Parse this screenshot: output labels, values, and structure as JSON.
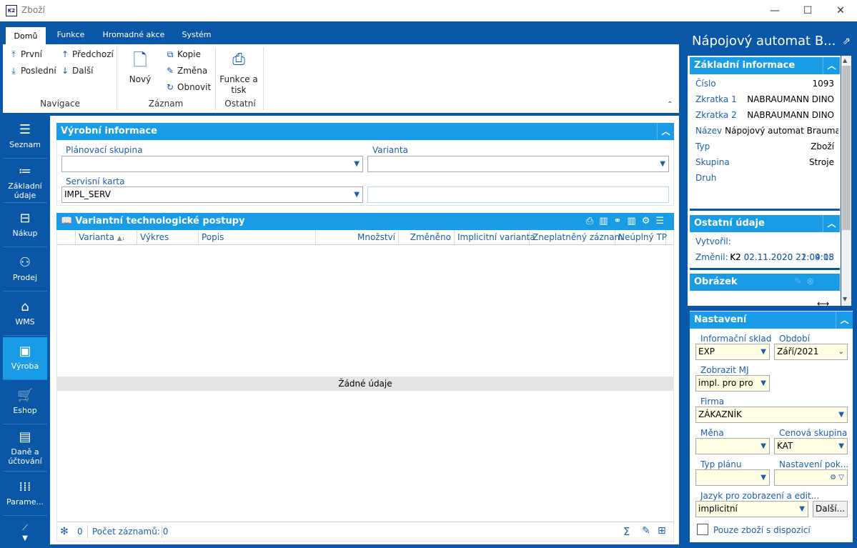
{
  "window": {
    "title": "Zboží",
    "icon": "K2",
    "buttons": [
      "—",
      "☐",
      "✕"
    ]
  },
  "ribbon": {
    "tabs": [
      "Domů",
      "Funkce",
      "Hromadné akce",
      "Systém"
    ],
    "nav": {
      "first": "První",
      "last": "Poslední",
      "prev": "Předchozí",
      "next": "Další",
      "group": "Navigace"
    },
    "record": {
      "new": "Nový",
      "copy": "Kopie",
      "change": "Změna",
      "refresh": "Obnovit",
      "group": "Záznam"
    },
    "other": {
      "print": "Funkce a tisk",
      "group": "Ostatní"
    }
  },
  "leftnav": [
    {
      "label": "Seznam",
      "icon": "list-icon"
    },
    {
      "label": "Základní údaje",
      "icon": "bullets-icon"
    },
    {
      "label": "Nákup",
      "icon": "purchase-icon"
    },
    {
      "label": "Prodej",
      "icon": "sale-icon"
    },
    {
      "label": "WMS",
      "icon": "warehouse-icon"
    },
    {
      "label": "Výroba",
      "icon": "production-icon"
    },
    {
      "label": "Eshop",
      "icon": "cart-icon"
    },
    {
      "label": "Daně a účtování",
      "icon": "ledger-icon"
    },
    {
      "label": "Parame...",
      "icon": "grid-icon"
    }
  ],
  "production": {
    "title": "Výrobní informace",
    "planning_group_label": "Plánovací skupina",
    "planning_group_value": "",
    "variant_label": "Varianta",
    "variant_value": "",
    "service_card_label": "Servisní karta",
    "service_card_value": "IMPL_SERV"
  },
  "tech": {
    "title": "Variantní technologické postupy",
    "columns": [
      "Varianta",
      "Výkres",
      "Popis",
      "Množství",
      "Změněno",
      "Implicitní varianta",
      "Zneplatněný záznam",
      "Neúplný TP"
    ],
    "empty": "Žádné údaje",
    "footer_count": "0",
    "footer_records": "Počet záznamů: 0"
  },
  "detail": {
    "title": "Nápojový automat B...",
    "basic_header": "Základní informace",
    "rows": [
      {
        "k": "Číslo",
        "v": "1093"
      },
      {
        "k": "Zkratka 1",
        "v": "NABRAUMANN DINO"
      },
      {
        "k": "Zkratka 2",
        "v": "NABRAUMANN DINO"
      },
      {
        "k": "Název",
        "v": "Nápojový automat Brauman..."
      },
      {
        "k": "Typ",
        "v": "Zboží"
      },
      {
        "k": "Skupina",
        "v": "Stroje"
      },
      {
        "k": "Druh",
        "v": ""
      }
    ],
    "other_header": "Ostatní údaje",
    "created_label": "Vytvořil:",
    "created_user": "K2",
    "created_date": "02.11.2020 21:04:15",
    "changed_label": "Změnil:",
    "changed_user": "K2",
    "changed_date": "02.11.2020 22:09:08",
    "image_header": "Obrázek"
  },
  "settings": {
    "header": "Nastavení",
    "stock_label": "Informační sklad",
    "stock_value": "EXP",
    "period_label": "Období",
    "period_value": "Září/2021",
    "unit_label": "Zobrazit MJ",
    "unit_value": "impl. pro pro",
    "firm_label": "Firma",
    "firm_value": "ZÁKAZNÍK",
    "currency_label": "Měna",
    "currency_value": "",
    "price_group_label": "Cenová skupina",
    "price_group_value": "KAT",
    "plan_type_label": "Typ plánu",
    "plan_type_value": "",
    "adv_label": "Nastavení pok...",
    "adv_value": "",
    "lang_label": "Jazyk pro zobrazení a edit...",
    "lang_value": "implicitní",
    "more_button": "Další...",
    "only_available": "Pouze zboží s dispozicí"
  }
}
